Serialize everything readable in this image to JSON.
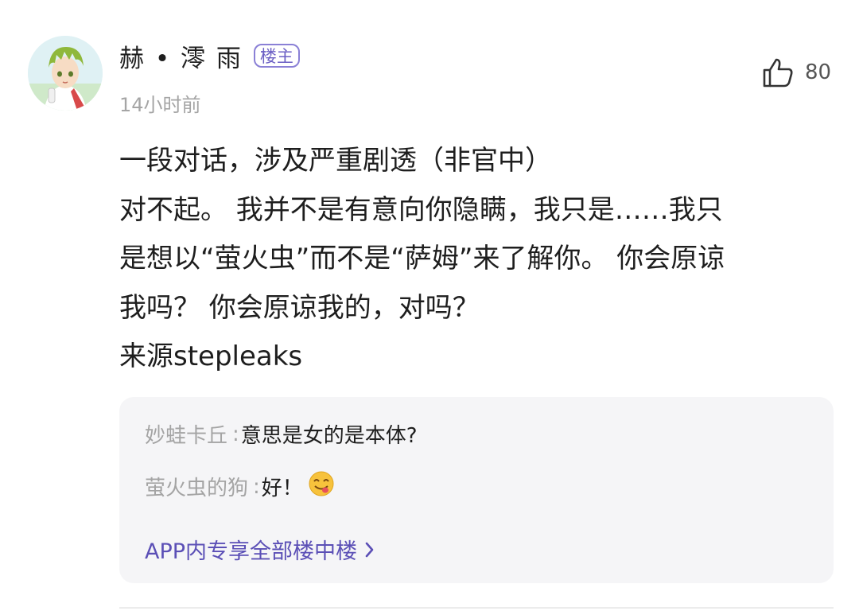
{
  "comment": {
    "author": "赫 • 澪 雨",
    "op_badge": "楼主",
    "time": "14小时前",
    "like_count": "80",
    "body_lines": [
      "一段对话，涉及严重剧透（非官中）",
      "对不起。 我并不是有意向你隐瞒，我只是……我只",
      "是想以“萤火虫”而不是“萨姆”来了解你。 你会原谅",
      "我吗？ 你会原谅我的，对吗？",
      "来源stepleaks"
    ]
  },
  "replies": {
    "items": [
      {
        "author": "妙蛙卡丘",
        "colon": ":",
        "text": "意思是女的是本体?"
      },
      {
        "author": "萤火虫的狗",
        "colon": ":",
        "text": "好！",
        "emoji": "yum-face-emoji"
      }
    ],
    "more_label": "APP内专享全部楼中楼"
  },
  "icons": {
    "like": "thumbs-up-icon",
    "more": "chevron-right-icon"
  },
  "colors": {
    "accent": "#5b4fb6",
    "badge_border": "#8a80d6",
    "muted_text": "#a4a4a4",
    "reply_bg": "#f5f5f7"
  }
}
